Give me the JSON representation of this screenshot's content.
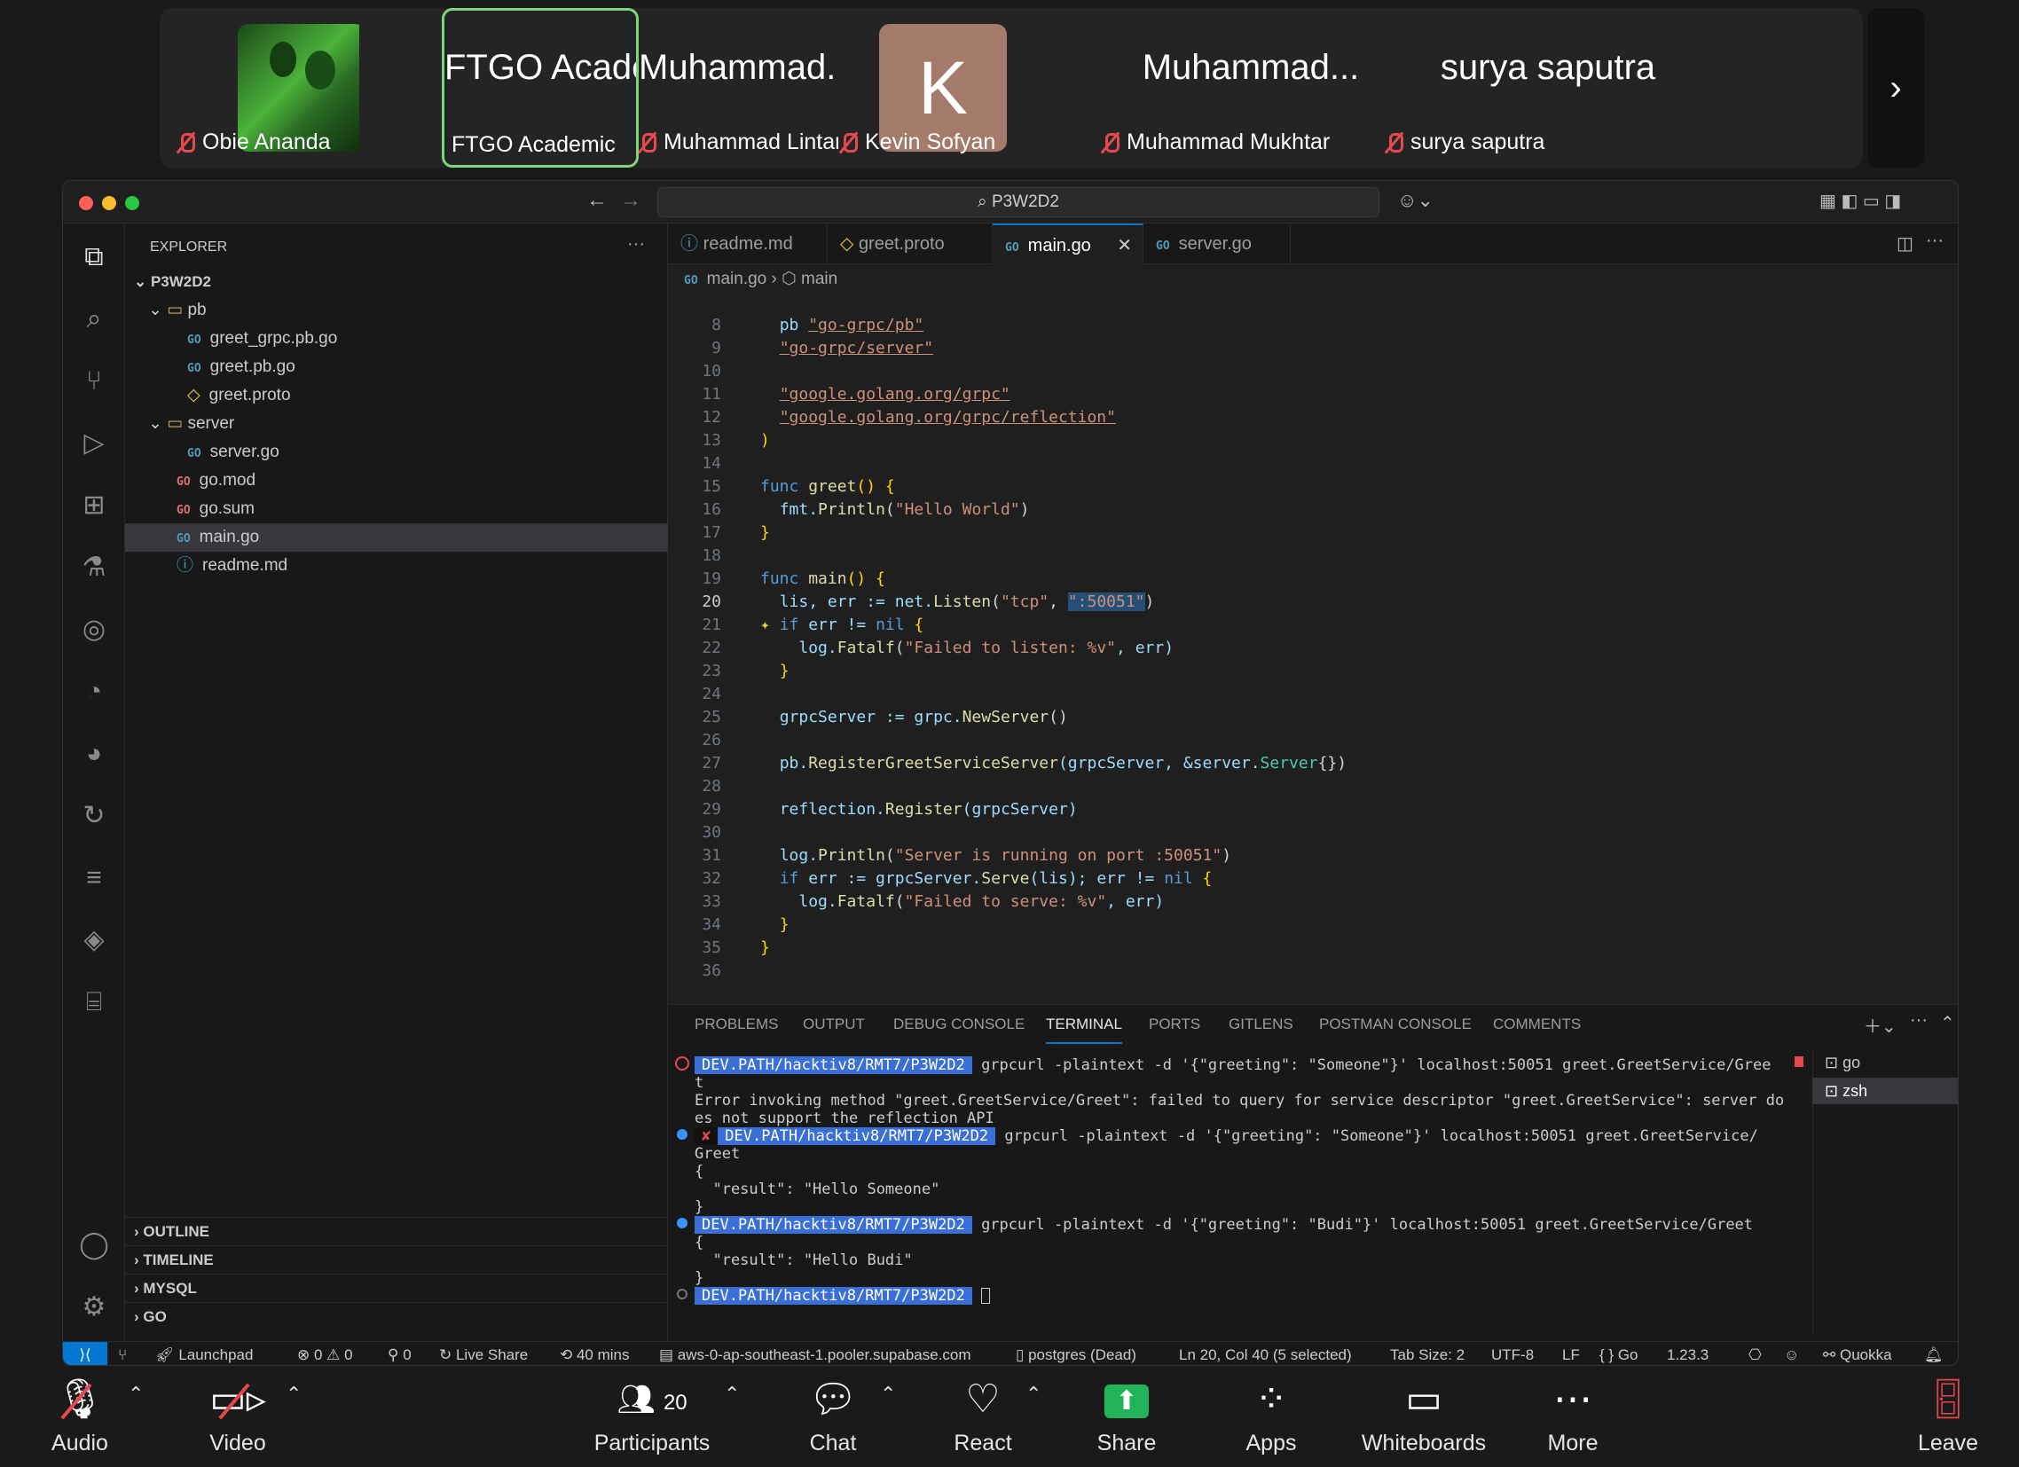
{
  "participants": [
    {
      "big": "",
      "name": "Obie Ananda",
      "muted": true
    },
    {
      "big": "FTGO Acade...",
      "name": "FTGO Academic",
      "muted": false,
      "active": true
    },
    {
      "big": "Muhammad...",
      "name": "Muhammad Lintang",
      "muted": true
    },
    {
      "big": "K",
      "name": "Kevin Sofyan",
      "muted": true
    },
    {
      "big": "Muhammad...",
      "name": "Muhammad Mukhtar",
      "muted": true
    },
    {
      "big": "surya saputra",
      "name": "surya saputra",
      "muted": true
    }
  ],
  "strip_next": "›",
  "window": {
    "search": "P3W2D2"
  },
  "explorer": {
    "title": "EXPLORER",
    "root": "P3W2D2",
    "items": [
      "pb",
      "greet_grpc.pb.go",
      "greet.pb.go",
      "greet.proto",
      "server",
      "server.go",
      "go.mod",
      "go.sum",
      "main.go",
      "readme.md"
    ],
    "sections": [
      "OUTLINE",
      "TIMELINE",
      "MYSQL",
      "GO"
    ]
  },
  "tabs": [
    "readme.md",
    "greet.proto",
    "main.go",
    "server.go"
  ],
  "breadcrumb": {
    "file": "main.go",
    "symbol": "main"
  },
  "code_lines": [
    "8",
    "9",
    "10",
    "11",
    "12",
    "13",
    "14",
    "15",
    "16",
    "17",
    "18",
    "19",
    "20",
    "21",
    "22",
    "23",
    "24",
    "25",
    "26",
    "27",
    "28",
    "29",
    "30",
    "31",
    "32",
    "33",
    "34",
    "35",
    "36"
  ],
  "code_text": {
    "l8a": "pb ",
    "l8b": "\"go-grpc/pb\"",
    "l9": "\"go-grpc/server\"",
    "l11": "\"google.golang.org/grpc\"",
    "l12": "\"google.golang.org/grpc/reflection\"",
    "l13": ")",
    "l15a": "func ",
    "l15b": "greet",
    "l15c": "() {",
    "l16a": "fmt.",
    "l16b": "Println",
    "l16c": "(",
    "l16d": "\"Hello World\"",
    "l16e": ")",
    "l17": "}",
    "l19a": "func ",
    "l19b": "main",
    "l19c": "() {",
    "l20a": "lis, err := net.",
    "l20b": "Listen",
    "l20c": "(",
    "l20d": "\"tcp\"",
    "l20e": ", ",
    "l20f": "\":50051\"",
    "l20g": ")",
    "l21a": "if ",
    "l21b": "err != ",
    "l21c": "nil",
    "l21d": " {",
    "l22a": "log.",
    "l22b": "Fatalf",
    "l22c": "(",
    "l22d": "\"Failed to listen: %v\"",
    "l22e": ", err)",
    "l23": "}",
    "l25a": "grpcServer := grpc.",
    "l25b": "NewServer",
    "l25c": "()",
    "l27a": "pb.",
    "l27b": "RegisterGreetServiceServer",
    "l27c": "(grpcServer, &server.",
    "l27d": "Server",
    "l27e": "{})",
    "l29a": "reflection.",
    "l29b": "Register",
    "l29c": "(grpcServer)",
    "l31a": "log.",
    "l31b": "Println",
    "l31c": "(",
    "l31d": "\"Server is running on port :50051\"",
    "l31e": ")",
    "l32a": "if ",
    "l32b": "err := grpcServer.",
    "l32c": "Serve",
    "l32d": "(lis); err != ",
    "l32e": "nil",
    "l32f": " {",
    "l33a": "log.",
    "l33b": "Fatalf",
    "l33c": "(",
    "l33d": "\"Failed to serve: %v\"",
    "l33e": ", err)",
    "l34": "}",
    "l35": "}"
  },
  "panel_tabs": [
    "PROBLEMS",
    "OUTPUT",
    "DEBUG CONSOLE",
    "TERMINAL",
    "PORTS",
    "GITLENS",
    "POSTMAN CONSOLE",
    "COMMENTS"
  ],
  "terminal": {
    "prompt": "DEV.PATH/hacktiv8/RMT7/P3W2D2",
    "l1": "grpcurl -plaintext -d '{\"greeting\": \"Someone\"}' localhost:50051 greet.GreetService/Gree",
    "l2": "t",
    "l3": "Error invoking method \"greet.GreetService/Greet\": failed to query for service descriptor \"greet.GreetService\": server do",
    "l4": "es not support the reflection API",
    "l5": "grpcurl -plaintext -d '{\"greeting\": \"Someone\"}' localhost:50051 greet.GreetService/",
    "l6": "Greet",
    "l7": "{",
    "l8": "  \"result\": \"Hello Someone\"",
    "l9": "}",
    "l10": "grpcurl -plaintext -d '{\"greeting\": \"Budi\"}' localhost:50051 greet.GreetService/Greet",
    "l11": "{",
    "l12": "  \"result\": \"Hello Budi\"",
    "l13": "}",
    "sessions": [
      "go",
      "zsh"
    ]
  },
  "status": {
    "launchpad": "Launchpad",
    "problems": "⊗ 0 ⚠ 0",
    "ports": "0",
    "liveshare": "Live Share",
    "time": "40 mins",
    "db": "aws-0-ap-southeast-1.pooler.supabase.com",
    "pg": "postgres (Dead)",
    "cursor": "Ln 20, Col 40 (5 selected)",
    "tab": "Tab Size: 2",
    "enc": "UTF-8",
    "eol": "LF",
    "lang": "Go",
    "ver": "1.23.3",
    "quokka": "Quokka"
  },
  "zoom": {
    "audio": "Audio",
    "video": "Video",
    "participants": "Participants",
    "participants_count": "20",
    "chat": "Chat",
    "react": "React",
    "share": "Share",
    "apps": "Apps",
    "whiteboards": "Whiteboards",
    "more": "More",
    "leave": "Leave"
  },
  "colors": {
    "accent": "#0078d4",
    "active_speaker": "#7ed67b",
    "share_green": "#20b35a",
    "muted_red": "#e5484d"
  }
}
